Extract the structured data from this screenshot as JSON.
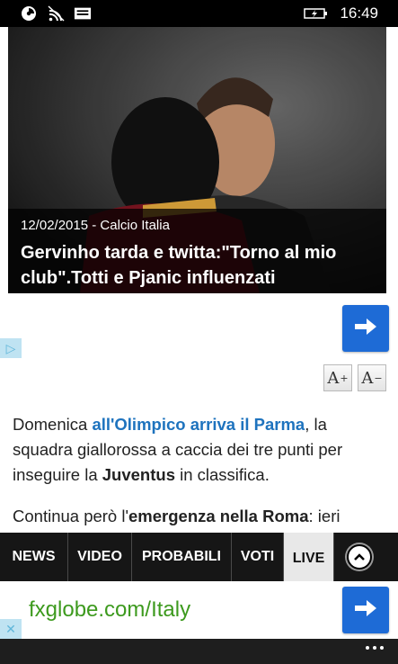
{
  "status_bar": {
    "time": "16:49"
  },
  "article": {
    "date_category": "12/02/2015 - Calcio Italia",
    "title": "Gervinho tarda e twitta:\"Torno al mio club\".Totti e Pjanic influenzati",
    "para1": {
      "t1": "Domenica ",
      "link1": "all'Olimpico arriva il Parma",
      "t2": ", la squadra giallorossa a caccia dei tre punti per inseguire la ",
      "bold1": "Juventus",
      "t3": " in classifica."
    },
    "para2": {
      "t1": "Continua però l'",
      "bold1": "emergenza nella Roma",
      "t2": ": ieri"
    }
  },
  "text_size": {
    "increase_label": "A",
    "increase_sup": "+",
    "decrease_label": "A",
    "decrease_sup": "−"
  },
  "nav": {
    "tabs": [
      "NEWS",
      "VIDEO",
      "PROBABILI",
      "VOTI",
      "LIVE"
    ],
    "active": "LIVE"
  },
  "ad_bottom": {
    "text": "fxglobe.com/Italy"
  },
  "colors": {
    "accent_blue": "#1e6bd6",
    "link_blue": "#1e73be",
    "ad_green": "#3d9a1e"
  }
}
